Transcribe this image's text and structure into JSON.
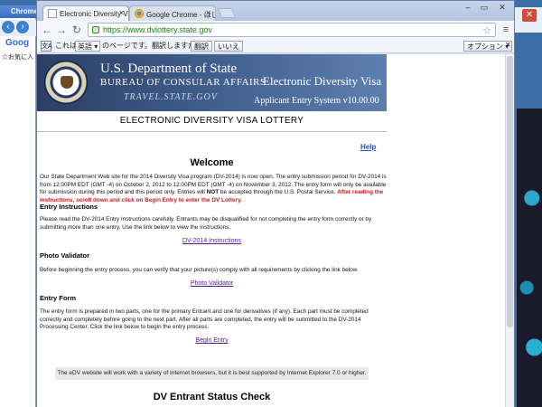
{
  "background": {
    "left_window_title": "Chrome",
    "left_google": "Goog",
    "left_favorites": "お気に入"
  },
  "browser": {
    "tabs": [
      {
        "label": "Electronic Diversity Visa L"
      },
      {
        "label": "Google Chrome - はじめに(F"
      }
    ],
    "url": "https://www.dvlottery.state.gov",
    "menu_icon": "≡"
  },
  "translate_bar": {
    "prefix": "これは",
    "language": "英語",
    "question": "のページです。翻訳しますか？",
    "translate_button": "翻訳",
    "no_button": "いいえ",
    "options_button": "オプション",
    "icon_text": "文A"
  },
  "banner": {
    "dept": "U.S. Department of State",
    "bureau": "BUREAU OF CONSULAR AFFAIRS",
    "travel": "TRAVEL.STATE.GOV",
    "edv": "Electronic Diversity Visa",
    "aes": "Applicant Entry System  v10.00.00"
  },
  "page": {
    "title": "ELECTRONIC DIVERSITY VISA LOTTERY",
    "help": "Help",
    "welcome": "Welcome",
    "intro_1": "Our State Department Web site for the 2014 Diversity Visa program (DV-2014) is now open. The entry submission period for DV-2014 is from 12:00PM EDT (GMT -4) on October 2, 2012 to 12:00PM EDT (GMT -4) on November 3, 2012. The entry form will only be available for submission during this period and this period only. Entries will",
    "intro_not": "NOT",
    "intro_2": "be accepted through the U.S. Postal Service.",
    "intro_red": "After reading the instructions, scroll down and click on Begin Entry to enter the DV Lottery.",
    "entry_heading": "Entry Instructions",
    "entry_text": "Please read the DV-2014 Entry Instructions carefully. Entrants may be disqualified for not completing the entry form correctly or by submitting more than one entry. Use the link below to view the instructions.",
    "entry_link": "DV-2014 Instructions",
    "photo_heading": "Photo Validator",
    "photo_text": "Before beginning the entry process, you can verify that your picture(s) comply with all requirements by clicking the link below.",
    "photo_link": "Photo Validator",
    "form_heading": "Entry Form",
    "form_text": "The entry form is prepared in two parts, one for the primary Entrant and one for derivatives (if any). Each part must be completed correctly and completely before going to the next part. After all parts are completed, the entry will be submitted to the DV-2014 Processing Center. Click the link below to begin the entry process.",
    "form_link": "Begin Entry",
    "notice": "The eDV website will work with a variety of Internet browsers, but it is best supported by Internet Explorer 7.0 or higher.",
    "status_heading": "DV Entrant Status Check"
  }
}
